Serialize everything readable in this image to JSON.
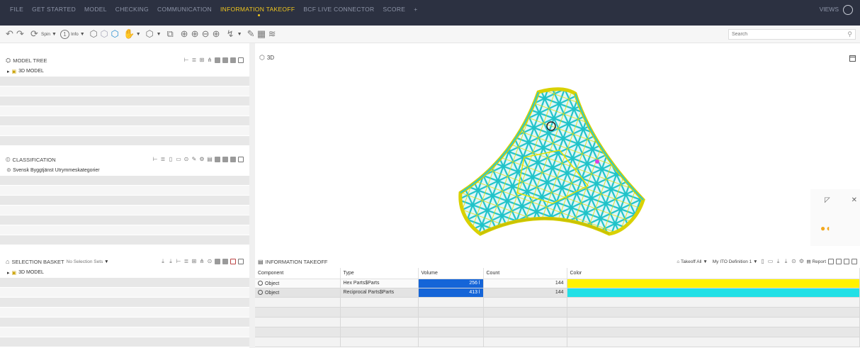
{
  "menu": {
    "items": [
      "FILE",
      "GET STARTED",
      "MODEL",
      "CHECKING",
      "COMMUNICATION",
      "INFORMATION TAKEOFF",
      "BCF LIVE CONNECTOR",
      "SCORE",
      "+"
    ],
    "active_index": 5,
    "views_label": "VIEWS"
  },
  "toolbar": {
    "spin_label": "Spin",
    "info_label": "Info",
    "search_placeholder": "Search"
  },
  "model_tree": {
    "title": "MODEL TREE",
    "items": [
      "3D MODEL"
    ]
  },
  "classification": {
    "title": "CLASSIFICATION",
    "items": [
      "Svensk Byggtjänst Utrymmeskategorier"
    ]
  },
  "selection_basket": {
    "title": "SELECTION BASKET",
    "sets_label": "No Selection Sets",
    "items": [
      "3D MODEL"
    ]
  },
  "view3d": {
    "title": "3D"
  },
  "info_takeoff": {
    "title": "INFORMATION TAKEOFF",
    "takeoff_all_label": "Takeoff All",
    "definition_label": "My ITO Definition 1",
    "report_label": "Report",
    "columns": [
      "Component",
      "Type",
      "Volume",
      "Count",
      "Color"
    ],
    "rows": [
      {
        "component": "Object",
        "type": "Hex Parts$Parts",
        "volume": "256 l",
        "count": "144",
        "color": "#fff200"
      },
      {
        "component": "Object",
        "type": "Reciprocal Parts$Parts",
        "volume": "413 l",
        "count": "144",
        "color": "#22e0e6"
      }
    ]
  },
  "colors": {
    "menubar_bg": "#2c3141",
    "menu_active": "#f2c81e",
    "selection_blue": "#1565d8",
    "model_yellow": "#e6e000",
    "model_cyan": "#26c9cf"
  }
}
